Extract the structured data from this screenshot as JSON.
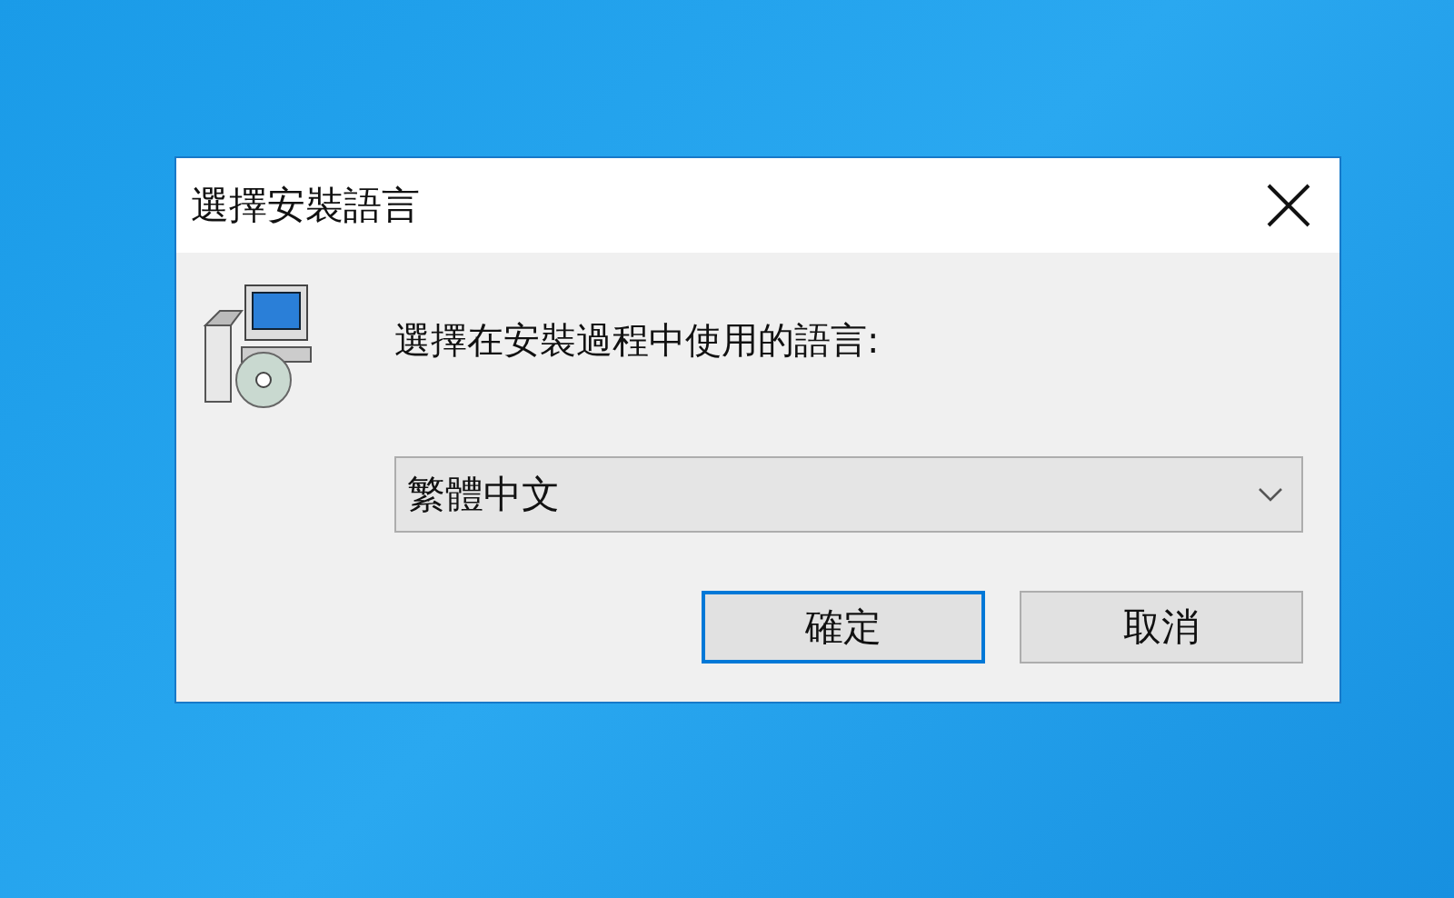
{
  "window": {
    "title": "選擇安裝語言"
  },
  "prompt": "選擇在安裝過程中使用的語言:",
  "language_select": {
    "value": "繁體中文"
  },
  "buttons": [
    {
      "label": "確定",
      "default": true
    },
    {
      "label": "取消",
      "default": false
    }
  ]
}
